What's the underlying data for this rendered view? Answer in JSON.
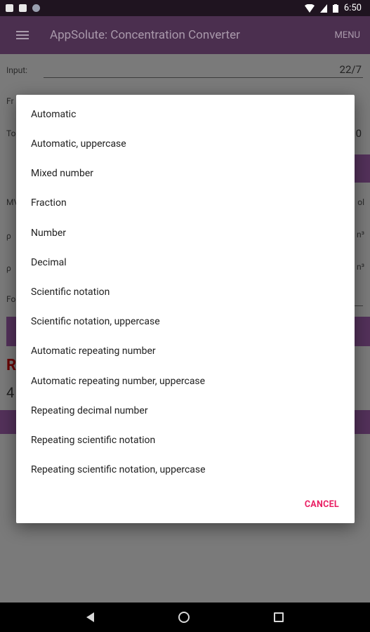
{
  "status_bar": {
    "time": "6:50",
    "icons": [
      "notification-icon",
      "sim-icon",
      "cloud-icon",
      "wifi-icon",
      "signal-icon",
      "battery-icon"
    ]
  },
  "app_bar": {
    "title": "AppSolute: Concentration Converter",
    "menu_label": "MENU",
    "icon": "hamburger-menu-icon"
  },
  "background": {
    "input_label": "Input:",
    "input_value": "22/7",
    "from_label": "Fr",
    "to_label": "To",
    "to_value_partial": "0",
    "mw_label": "MV",
    "mw_unit_partial": "ol",
    "rho1_label": "ρ",
    "rho1_unit_partial": "n³",
    "rho2_label": "ρ",
    "rho2_unit_partial": "n³",
    "format_label": "Fo",
    "result_partial": "R",
    "number_partial": "4"
  },
  "dialog": {
    "options": [
      "Automatic",
      "Automatic, uppercase",
      "Mixed number",
      "Fraction",
      "Number",
      "Decimal",
      "Scientific notation",
      "Scientific notation, uppercase",
      "Automatic repeating number",
      "Automatic repeating number, uppercase",
      "Repeating decimal number",
      "Repeating scientific notation",
      "Repeating scientific notation, uppercase"
    ],
    "cancel_label": "CANCEL"
  },
  "colors": {
    "primary": "#4b2f4f",
    "accent": "#e91e63"
  },
  "nav_bar": {
    "icons": [
      "back-icon",
      "home-icon",
      "recents-icon"
    ]
  }
}
